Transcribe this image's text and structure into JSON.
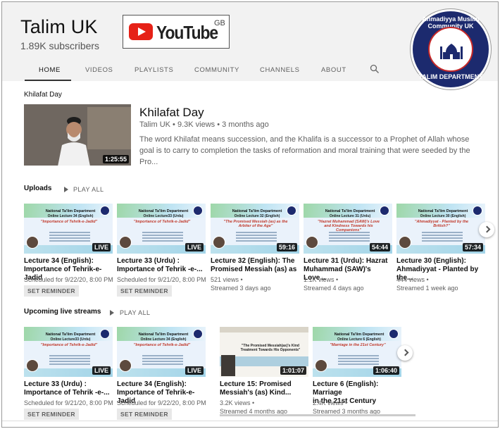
{
  "channel": {
    "name": "Talim UK",
    "subscribers": "1.89K subscribers",
    "logo_word": "YouTube",
    "logo_region": "GB",
    "emblem_top": "Ahmadiyya Muslim Community UK",
    "emblem_bottom": "TALIM DEPARTMENT"
  },
  "tabs": [
    {
      "label": "HOME",
      "active": true
    },
    {
      "label": "VIDEOS"
    },
    {
      "label": "PLAYLISTS"
    },
    {
      "label": "COMMUNITY"
    },
    {
      "label": "CHANNELS"
    },
    {
      "label": "ABOUT"
    }
  ],
  "featured": {
    "section_label": "Khilafat Day",
    "title": "Khilafat Day",
    "meta": "Talim UK • 9.3K views • 3 months ago",
    "duration": "1:25:55",
    "description": "The word Khilafat means succession, and the Khalifa is a successor to a Prophet of Allah whose goal is to carry to completion the tasks of reformation and moral training that were seeded by the Pro..."
  },
  "uploads": {
    "heading": "Uploads",
    "play_all": "PLAY ALL",
    "items": [
      {
        "title_line1": "Lecture 34 (English):",
        "title_line2": "Importance of Tehrik-e-Jadid",
        "meta1": "Scheduled for 9/22/20, 8:00 PM",
        "reminder": "SET REMINDER",
        "badge": "LIVE",
        "thumb_org": "National Ta'lim Department",
        "thumb_sub": "Online Lecture 34 (English)",
        "thumb_quote": "\"Importance of Tehrik-e-Jadid\""
      },
      {
        "title_line1": "Lecture 33 (Urdu) :",
        "title_line2": "Importance of Tehrik -e-...",
        "meta1": "Scheduled for 9/21/20, 8:00 PM",
        "reminder": "SET REMINDER",
        "badge": "LIVE",
        "thumb_org": "National Ta'lim Department",
        "thumb_sub": "Online Lecture33 (Urdu)",
        "thumb_quote": "\"Importance of Tehrik-e-Jadid\""
      },
      {
        "title_line1": "Lecture 32 (English): The",
        "title_line2": "Promised Messiah (as) as",
        "meta1": "521 views •",
        "meta2": "Streamed 3 days ago",
        "badge": "59:16",
        "thumb_org": "National Ta'lim Department",
        "thumb_sub": "Online Lecture 32 (English)",
        "thumb_quote": "\"The Promised Messiah (as) as the Arbiter of the Age\""
      },
      {
        "title_line1": "Lecture 31 (Urdu): Hazrat",
        "title_line2": "Muhammad (SAW)'s Love...",
        "meta1": "1.1K views •",
        "meta2": "Streamed 4 days ago",
        "badge": "54:44",
        "thumb_org": "National Ta'lim Department",
        "thumb_sub": "Online Lecture 31 (Urdu)",
        "thumb_quote": "\"Hazrat Muhammad (SAW)'s Love and Kindness Towards his Companions\""
      },
      {
        "title_line1": "Lecture 30 (English):",
        "title_line2": "Ahmadiyyat - Planted by the...",
        "meta1": "444 views •",
        "meta2": "Streamed 1 week ago",
        "badge": "57:34",
        "thumb_org": "National Ta'lim Department",
        "thumb_sub": "Online Lecture 30 (English)",
        "thumb_quote": "\"Ahmadiyyat - Planted by the British?\""
      }
    ]
  },
  "upcoming": {
    "heading": "Upcoming live streams",
    "play_all": "PLAY ALL",
    "items": [
      {
        "title_line1": "Lecture 33 (Urdu) :",
        "title_line2": "Importance of Tehrik -e-...",
        "meta1": "Scheduled for 9/21/20, 8:00 PM",
        "reminder": "SET REMINDER",
        "badge": "LIVE",
        "thumb_org": "National Ta'lim Department",
        "thumb_sub": "Online Lecture33 (Urdu)",
        "thumb_quote": "\"Importance of Tehrik-e-Jadid\""
      },
      {
        "title_line1": "Lecture 34 (English):",
        "title_line2": "Importance of Tehrik-e-Jadid",
        "meta1": "Scheduled for 9/22/20, 8:00 PM",
        "reminder": "SET REMINDER",
        "badge": "LIVE",
        "thumb_org": "National Ta'lim Department",
        "thumb_sub": "Online Lecture 34 (English)",
        "thumb_quote": "\"Importance of Tehrik-e-Jadid\""
      },
      {
        "title_line1": "Lecture 15: Promised",
        "title_line2": "Messiah's (as) Kind...",
        "meta1": "3.2K views •",
        "meta2": "Streamed 4 months ago",
        "badge": "1:01:07",
        "thumb_quote": "\"The Promised Messiah(as)'s Kind Treatment Towards His Opponents\"",
        "watched_fraction": 0.9
      },
      {
        "title_line1": "Lecture 6 (English): Marriage",
        "title_line2": "in the 21st Century",
        "meta1": "2.4K views •",
        "meta2": "Streamed 3 months ago",
        "badge": "1:06:40",
        "thumb_org": "National Ta'lim Department",
        "thumb_sub": "Online Lecture 6 (English)",
        "thumb_quote": "\"Marriage in the 21st Century\"",
        "watched_fraction": 1.0
      }
    ]
  },
  "colors": {
    "accent_red": "#cc0000",
    "live_badge_bg": "#000000",
    "header_bg": "#f2f2f2"
  },
  "icons": {
    "search": "search-icon",
    "next": "chevron-right-icon",
    "play_all": "play-icon"
  }
}
